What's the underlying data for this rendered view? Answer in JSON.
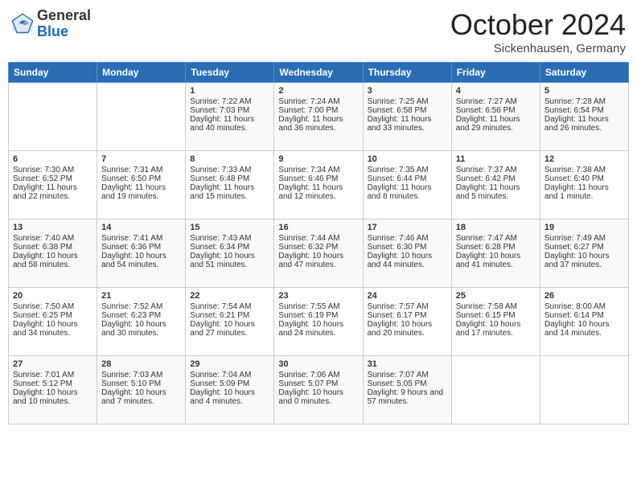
{
  "header": {
    "logo_general": "General",
    "logo_blue": "Blue",
    "month": "October 2024",
    "location": "Sickenhausen, Germany"
  },
  "days_of_week": [
    "Sunday",
    "Monday",
    "Tuesday",
    "Wednesday",
    "Thursday",
    "Friday",
    "Saturday"
  ],
  "weeks": [
    [
      {
        "day": "",
        "sunrise": "",
        "sunset": "",
        "daylight": ""
      },
      {
        "day": "",
        "sunrise": "",
        "sunset": "",
        "daylight": ""
      },
      {
        "day": "1",
        "sunrise": "Sunrise: 7:22 AM",
        "sunset": "Sunset: 7:03 PM",
        "daylight": "Daylight: 11 hours and 40 minutes."
      },
      {
        "day": "2",
        "sunrise": "Sunrise: 7:24 AM",
        "sunset": "Sunset: 7:00 PM",
        "daylight": "Daylight: 11 hours and 36 minutes."
      },
      {
        "day": "3",
        "sunrise": "Sunrise: 7:25 AM",
        "sunset": "Sunset: 6:58 PM",
        "daylight": "Daylight: 11 hours and 33 minutes."
      },
      {
        "day": "4",
        "sunrise": "Sunrise: 7:27 AM",
        "sunset": "Sunset: 6:56 PM",
        "daylight": "Daylight: 11 hours and 29 minutes."
      },
      {
        "day": "5",
        "sunrise": "Sunrise: 7:28 AM",
        "sunset": "Sunset: 6:54 PM",
        "daylight": "Daylight: 11 hours and 26 minutes."
      }
    ],
    [
      {
        "day": "6",
        "sunrise": "Sunrise: 7:30 AM",
        "sunset": "Sunset: 6:52 PM",
        "daylight": "Daylight: 11 hours and 22 minutes."
      },
      {
        "day": "7",
        "sunrise": "Sunrise: 7:31 AM",
        "sunset": "Sunset: 6:50 PM",
        "daylight": "Daylight: 11 hours and 19 minutes."
      },
      {
        "day": "8",
        "sunrise": "Sunrise: 7:33 AM",
        "sunset": "Sunset: 6:48 PM",
        "daylight": "Daylight: 11 hours and 15 minutes."
      },
      {
        "day": "9",
        "sunrise": "Sunrise: 7:34 AM",
        "sunset": "Sunset: 6:46 PM",
        "daylight": "Daylight: 11 hours and 12 minutes."
      },
      {
        "day": "10",
        "sunrise": "Sunrise: 7:35 AM",
        "sunset": "Sunset: 6:44 PM",
        "daylight": "Daylight: 11 hours and 8 minutes."
      },
      {
        "day": "11",
        "sunrise": "Sunrise: 7:37 AM",
        "sunset": "Sunset: 6:42 PM",
        "daylight": "Daylight: 11 hours and 5 minutes."
      },
      {
        "day": "12",
        "sunrise": "Sunrise: 7:38 AM",
        "sunset": "Sunset: 6:40 PM",
        "daylight": "Daylight: 11 hours and 1 minute."
      }
    ],
    [
      {
        "day": "13",
        "sunrise": "Sunrise: 7:40 AM",
        "sunset": "Sunset: 6:38 PM",
        "daylight": "Daylight: 10 hours and 58 minutes."
      },
      {
        "day": "14",
        "sunrise": "Sunrise: 7:41 AM",
        "sunset": "Sunset: 6:36 PM",
        "daylight": "Daylight: 10 hours and 54 minutes."
      },
      {
        "day": "15",
        "sunrise": "Sunrise: 7:43 AM",
        "sunset": "Sunset: 6:34 PM",
        "daylight": "Daylight: 10 hours and 51 minutes."
      },
      {
        "day": "16",
        "sunrise": "Sunrise: 7:44 AM",
        "sunset": "Sunset: 6:32 PM",
        "daylight": "Daylight: 10 hours and 47 minutes."
      },
      {
        "day": "17",
        "sunrise": "Sunrise: 7:46 AM",
        "sunset": "Sunset: 6:30 PM",
        "daylight": "Daylight: 10 hours and 44 minutes."
      },
      {
        "day": "18",
        "sunrise": "Sunrise: 7:47 AM",
        "sunset": "Sunset: 6:28 PM",
        "daylight": "Daylight: 10 hours and 41 minutes."
      },
      {
        "day": "19",
        "sunrise": "Sunrise: 7:49 AM",
        "sunset": "Sunset: 6:27 PM",
        "daylight": "Daylight: 10 hours and 37 minutes."
      }
    ],
    [
      {
        "day": "20",
        "sunrise": "Sunrise: 7:50 AM",
        "sunset": "Sunset: 6:25 PM",
        "daylight": "Daylight: 10 hours and 34 minutes."
      },
      {
        "day": "21",
        "sunrise": "Sunrise: 7:52 AM",
        "sunset": "Sunset: 6:23 PM",
        "daylight": "Daylight: 10 hours and 30 minutes."
      },
      {
        "day": "22",
        "sunrise": "Sunrise: 7:54 AM",
        "sunset": "Sunset: 6:21 PM",
        "daylight": "Daylight: 10 hours and 27 minutes."
      },
      {
        "day": "23",
        "sunrise": "Sunrise: 7:55 AM",
        "sunset": "Sunset: 6:19 PM",
        "daylight": "Daylight: 10 hours and 24 minutes."
      },
      {
        "day": "24",
        "sunrise": "Sunrise: 7:57 AM",
        "sunset": "Sunset: 6:17 PM",
        "daylight": "Daylight: 10 hours and 20 minutes."
      },
      {
        "day": "25",
        "sunrise": "Sunrise: 7:58 AM",
        "sunset": "Sunset: 6:15 PM",
        "daylight": "Daylight: 10 hours and 17 minutes."
      },
      {
        "day": "26",
        "sunrise": "Sunrise: 8:00 AM",
        "sunset": "Sunset: 6:14 PM",
        "daylight": "Daylight: 10 hours and 14 minutes."
      }
    ],
    [
      {
        "day": "27",
        "sunrise": "Sunrise: 7:01 AM",
        "sunset": "Sunset: 5:12 PM",
        "daylight": "Daylight: 10 hours and 10 minutes."
      },
      {
        "day": "28",
        "sunrise": "Sunrise: 7:03 AM",
        "sunset": "Sunset: 5:10 PM",
        "daylight": "Daylight: 10 hours and 7 minutes."
      },
      {
        "day": "29",
        "sunrise": "Sunrise: 7:04 AM",
        "sunset": "Sunset: 5:09 PM",
        "daylight": "Daylight: 10 hours and 4 minutes."
      },
      {
        "day": "30",
        "sunrise": "Sunrise: 7:06 AM",
        "sunset": "Sunset: 5:07 PM",
        "daylight": "Daylight: 10 hours and 0 minutes."
      },
      {
        "day": "31",
        "sunrise": "Sunrise: 7:07 AM",
        "sunset": "Sunset: 5:05 PM",
        "daylight": "Daylight: 9 hours and 57 minutes."
      },
      {
        "day": "",
        "sunrise": "",
        "sunset": "",
        "daylight": ""
      },
      {
        "day": "",
        "sunrise": "",
        "sunset": "",
        "daylight": ""
      }
    ]
  ]
}
